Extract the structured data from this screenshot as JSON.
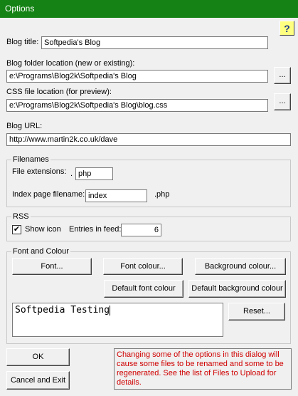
{
  "window": {
    "title": "Options",
    "help_label": "?"
  },
  "blog": {
    "title_label": "Blog title:",
    "title_value": "Softpedia's Blog",
    "folder_label": "Blog folder location (new or existing):",
    "folder_value": "e:\\Programs\\Blog2k\\Softpedia's Blog",
    "css_label": "CSS file location (for preview):",
    "css_value": "e:\\Programs\\Blog2k\\Softpedia's Blog\\blog.css",
    "url_label": "Blog URL:",
    "url_value": "http://www.martin2k.co.uk/dave",
    "browse_label": "..."
  },
  "filenames": {
    "group_label": "Filenames",
    "ext_label": "File extensions:",
    "ext_dot": ".",
    "ext_value": "php",
    "index_label": "Index page filename:",
    "index_value": "index",
    "index_suffix": ".php"
  },
  "rss": {
    "group_label": "RSS",
    "show_icon_label": "Show icon",
    "show_icon_checked": true,
    "check_mark": "✔",
    "entries_label": "Entries in feed:",
    "entries_value": "6"
  },
  "font": {
    "group_label": "Font and Colour",
    "font_button": "Font...",
    "font_colour_button": "Font colour...",
    "background_colour_button": "Background colour...",
    "default_font_colour_button": "Default font colour",
    "default_background_colour_button": "Default background colour",
    "preview_text": "Softpedia Testing",
    "reset_button": "Reset..."
  },
  "footer": {
    "ok_button": "OK",
    "cancel_button": "Cancel and Exit",
    "note": "Changing some of the options in this dialog will cause some files to be renamed and some to be regenerated.  See the list of Files to Upload for details."
  },
  "colors": {
    "titlebar": "#148214",
    "note_text": "#d00000"
  }
}
